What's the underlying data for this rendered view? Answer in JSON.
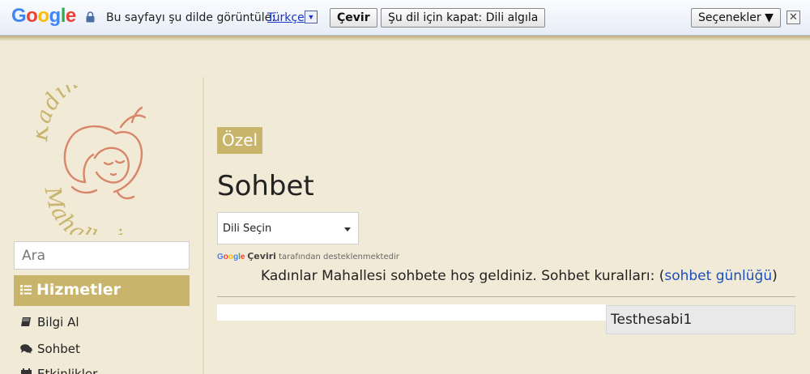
{
  "translate_bar": {
    "brand": [
      "G",
      "o",
      "o",
      "g",
      "l",
      "e"
    ],
    "brand_colors": [
      "#4285f4",
      "#ea4335",
      "#fbbc05",
      "#4285f4",
      "#34a853",
      "#ea4335"
    ],
    "prompt": "Bu sayfayı şu dilde görüntüle:",
    "language": "Türkçe",
    "translate_button": "Çevir",
    "disable_button": "Şu dil için kapat: Dili algıla",
    "options_button": "Seçenekler ▼",
    "close_glyph": "✕"
  },
  "sidebar": {
    "logo_text_top": "Kadınlar",
    "logo_text_bottom": "Mahallesi",
    "logo_color": "#d9856a",
    "logo_text_color": "#c8b46a",
    "search_placeholder": "Ara",
    "menu_title": "Hizmetler",
    "items": [
      {
        "label": "Bilgi Al",
        "icon": "book-icon"
      },
      {
        "label": "Sohbet",
        "icon": "comments-icon"
      },
      {
        "label": "Etkinlikler",
        "icon": "calendar-icon"
      }
    ]
  },
  "main": {
    "tag": "Özel",
    "title": "Sohbet",
    "language_select": "Dili Seçin",
    "powered_brand": "Google",
    "powered_service": "Çeviri",
    "powered_text": "tarafından desteklenmektedir",
    "welcome_text": "Kadınlar Mahallesi sohbete hoş geldiniz. Sohbet kuralları: (",
    "welcome_link": "sohbet günlüğü",
    "welcome_end": ")",
    "chat_user": "Testhesabi1"
  },
  "colors": {
    "accent": "#c8b46a",
    "background": "#f1ead6",
    "link": "#1a4fbf"
  }
}
